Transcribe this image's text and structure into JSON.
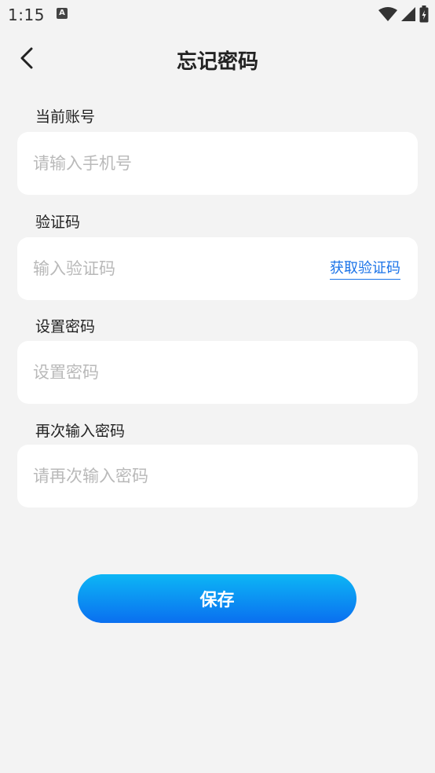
{
  "status_bar": {
    "time": "1:15",
    "notification_icon": "a-icon",
    "icons": [
      "wifi-icon",
      "signal-icon",
      "battery-icon"
    ]
  },
  "header": {
    "title": "忘记密码",
    "back_icon": "chevron-left-icon"
  },
  "form": {
    "account": {
      "label": "当前账号",
      "placeholder": "请输入手机号",
      "value": ""
    },
    "code": {
      "label": "验证码",
      "placeholder": "输入验证码",
      "value": "",
      "get_code_label": "获取验证码"
    },
    "password": {
      "label": "设置密码",
      "placeholder": "设置密码",
      "value": ""
    },
    "confirm_password": {
      "label": "再次输入密码",
      "placeholder": "请再次输入密码",
      "value": ""
    }
  },
  "save_button": {
    "label": "保存"
  },
  "colors": {
    "background": "#f3f3f3",
    "accent": "#1a73e8",
    "button_gradient_top": "#0db6f5",
    "button_gradient_bottom": "#0a6ff0"
  }
}
